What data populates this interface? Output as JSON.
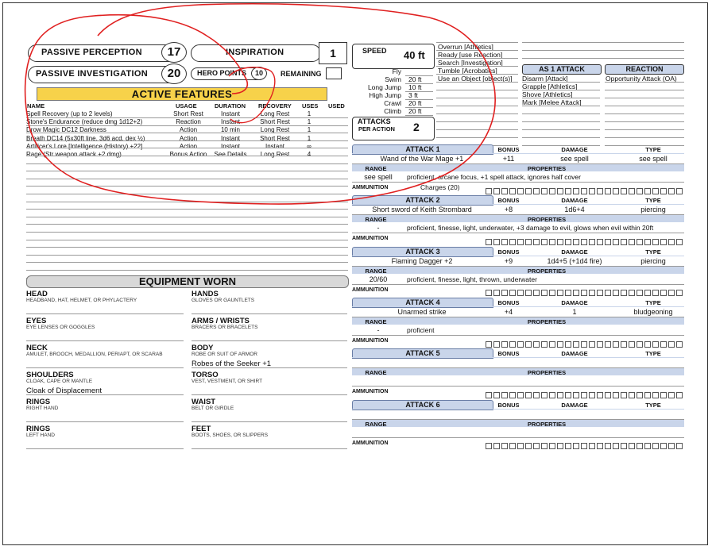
{
  "passive": {
    "perception_label": "PASSIVE PERCEPTION",
    "perception_value": "17",
    "investigation_label": "PASSIVE INVESTIGATION",
    "investigation_value": "20"
  },
  "inspiration": {
    "label": "INSPIRATION",
    "value": "1"
  },
  "hero": {
    "label": "HERO POINTS",
    "value": "10",
    "remaining_label": "REMAINING"
  },
  "speed": {
    "label": "SPEED",
    "value": "40 ft",
    "rows": [
      {
        "label": "Fly",
        "value": ""
      },
      {
        "label": "Swim",
        "value": "20 ft"
      },
      {
        "label": "Long Jump",
        "value": "10 ft"
      },
      {
        "label": "High Jump",
        "value": "3 ft"
      },
      {
        "label": "Crawl",
        "value": "20 ft"
      },
      {
        "label": "Climb",
        "value": "20 ft"
      }
    ]
  },
  "attacks_per_action": {
    "label1": "ATTACKS",
    "label2": "PER ACTION",
    "value": "2"
  },
  "actions_list": [
    "Overrun [Athletics]",
    "Ready [use Reaction]",
    "Search [Investigation]",
    "Tumble [Acrobatics]",
    "Use an Object [object(s)]"
  ],
  "as1attack": {
    "label": "AS 1 ATTACK",
    "items": [
      "Disarm [Attack]",
      "Grapple [Athletics]",
      "Shove [Athletics]",
      "Mark [Melee Attack]"
    ]
  },
  "reaction": {
    "label": "REACTION",
    "items": [
      "Opportunity Attack (OA)"
    ]
  },
  "active_features": {
    "title": "ACTIVE FEATURES",
    "headers": {
      "name": "NAME",
      "usage": "USAGE",
      "duration": "DURATION",
      "recovery": "RECOVERY",
      "uses": "USES",
      "used": "USED"
    },
    "rows": [
      {
        "name": "Spell Recovery (up to 2 levels)",
        "usage": "Short Rest",
        "duration": "Instant",
        "recovery": "Long Rest",
        "uses": "1"
      },
      {
        "name": "Stone's Endurance (reduce dmg 1d12+2)",
        "usage": "Reaction",
        "duration": "Instant",
        "recovery": "Short Rest",
        "uses": "1"
      },
      {
        "name": "Drow Magic DC12 Darkness",
        "usage": "Action",
        "duration": "10 min",
        "recovery": "Long Rest",
        "uses": "1"
      },
      {
        "name": "Breath DC14 (5x30ft line, 3d6 acd, dex ½)",
        "usage": "Action",
        "duration": "Instant",
        "recovery": "Short Rest",
        "uses": "1"
      },
      {
        "name": "Artificer's Lore [Intelligence (History) +22]",
        "usage": "Action",
        "duration": "Instant",
        "recovery": "Instant",
        "uses": "∞"
      },
      {
        "name": "Rage (Str weapon attack +2 dmg)",
        "usage": "Bonus Action",
        "duration": "See Details",
        "recovery": "Long Rest",
        "uses": "4"
      }
    ]
  },
  "equipment": {
    "title": "EQUIPMENT WORN",
    "slots": [
      {
        "name": "HEAD",
        "sub": "HEADBAND, HAT, HELMET, OR PHYLACTERY",
        "value": ""
      },
      {
        "name": "HANDS",
        "sub": "GLOVES OR GAUNTLETS",
        "value": ""
      },
      {
        "name": "EYES",
        "sub": "EYE LENSES OR GOGGLES",
        "value": ""
      },
      {
        "name": "ARMS / WRISTS",
        "sub": "BRACERS OR BRACELETS",
        "value": ""
      },
      {
        "name": "NECK",
        "sub": "AMULET, BROOCH, MEDALLION, PERIAPT, OR SCARAB",
        "value": ""
      },
      {
        "name": "BODY",
        "sub": "ROBE OR SUIT OF ARMOR",
        "value": "Robes of the Seeker +1"
      },
      {
        "name": "SHOULDERS",
        "sub": "CLOAK, CAPE OR MANTLE",
        "value": "Cloak of Displacement"
      },
      {
        "name": "TORSO",
        "sub": "VEST, VESTMENT, OR SHIRT",
        "value": ""
      },
      {
        "name": "RINGS",
        "sub": "RIGHT HAND",
        "value": ""
      },
      {
        "name": "WAIST",
        "sub": "BELT OR GIRDLE",
        "value": ""
      },
      {
        "name": "RINGS",
        "sub": "LEFT HAND",
        "value": ""
      },
      {
        "name": "FEET",
        "sub": "BOOTS, SHOES, OR SLIPPERS",
        "value": ""
      }
    ]
  },
  "attack_labels": {
    "bonus": "BONUS",
    "damage": "DAMAGE",
    "type": "TYPE",
    "range": "RANGE",
    "properties": "PROPERTIES",
    "ammunition": "AMMUNITION"
  },
  "attacks": [
    {
      "title": "ATTACK 1",
      "name": "Wand of the War Mage +1",
      "bonus": "+11",
      "damage": "see spell",
      "type": "see spell",
      "range": "see spell",
      "properties": "proficient, arcane focus, +1 spell attack, ignores half cover",
      "ammo_note": "Charges (20)"
    },
    {
      "title": "ATTACK 2",
      "name": "Short sword of Keith Strombard",
      "bonus": "+8",
      "damage": "1d6+4",
      "type": "piercing",
      "range": "-",
      "properties": "proficient, finesse, light, underwater, +3 damage to evil, glows when evil within 20ft",
      "ammo_note": ""
    },
    {
      "title": "ATTACK 3",
      "name": "Flaming Dagger +2",
      "bonus": "+9",
      "damage": "1d4+5 (+1d4 fire)",
      "type": "piercing",
      "range": "20/60",
      "properties": "proficient, finesse, light, thrown, underwater",
      "ammo_note": ""
    },
    {
      "title": "ATTACK 4",
      "name": "Unarmed strike",
      "bonus": "+4",
      "damage": "1",
      "type": "bludgeoning",
      "range": "-",
      "properties": "proficient",
      "ammo_note": ""
    },
    {
      "title": "ATTACK 5",
      "name": "",
      "bonus": "",
      "damage": "",
      "type": "",
      "range": "",
      "properties": "",
      "ammo_note": ""
    },
    {
      "title": "ATTACK 6",
      "name": "",
      "bonus": "",
      "damage": "",
      "type": "",
      "range": "",
      "properties": "",
      "ammo_note": ""
    }
  ],
  "colors": {
    "yellow": "#f7d24a",
    "attack_blue": "#c9d5ea",
    "annotation_red": "#e02020"
  }
}
